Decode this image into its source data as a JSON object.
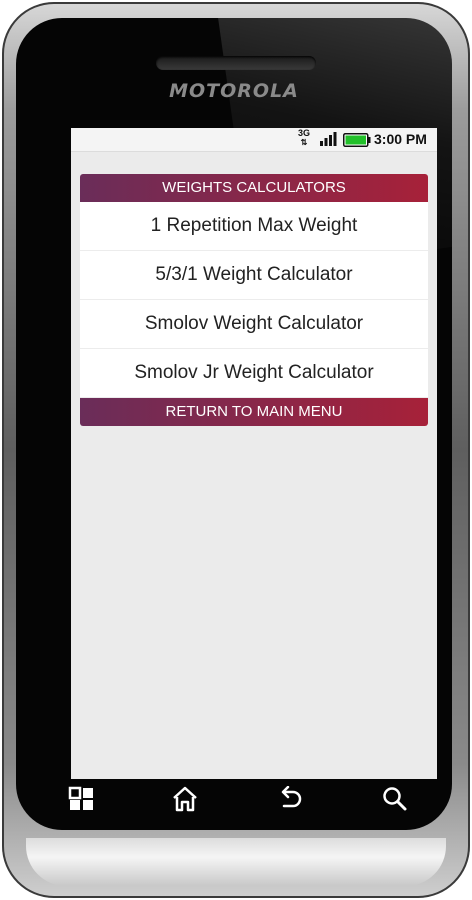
{
  "device": {
    "brand": "MOTOROLA"
  },
  "status_bar": {
    "network": "3G",
    "network_arrows": "⇅",
    "time": "3:00 PM",
    "battery_color": "#22c02a"
  },
  "menu": {
    "header": "WEIGHTS CALCULATORS",
    "items": [
      {
        "label": "1 Repetition Max Weight"
      },
      {
        "label": "5/3/1 Weight Calculator"
      },
      {
        "label": "Smolov Weight Calculator"
      },
      {
        "label": "Smolov Jr Weight Calculator"
      }
    ],
    "footer": "RETURN TO MAIN MENU",
    "accent_from": "#6a2d59",
    "accent_to": "#a72139"
  },
  "softkeys": [
    {
      "icon": "menu-grid-icon"
    },
    {
      "icon": "home-icon"
    },
    {
      "icon": "back-icon"
    },
    {
      "icon": "search-icon"
    }
  ]
}
